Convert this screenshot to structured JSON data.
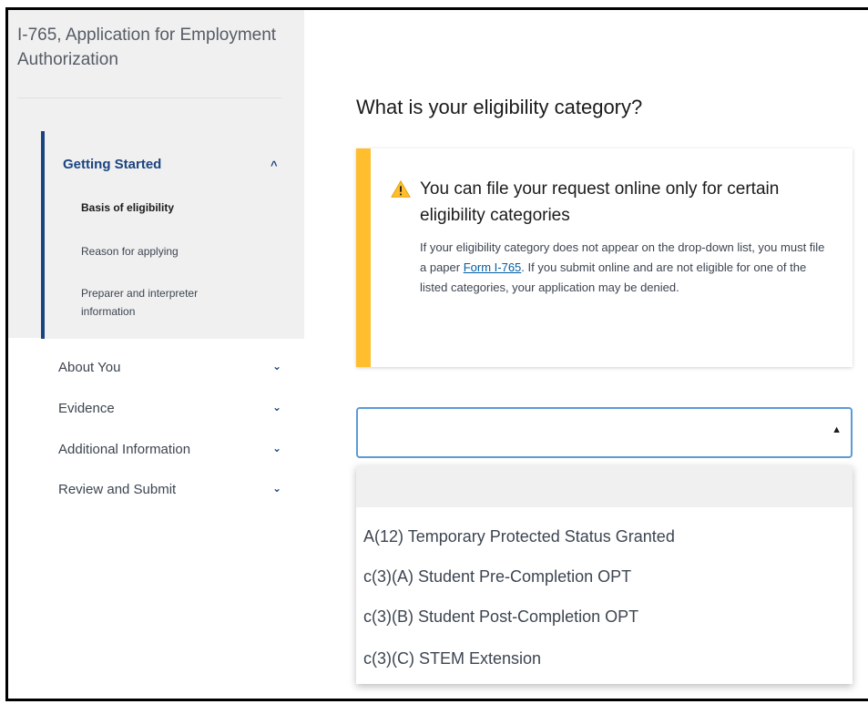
{
  "sidebar": {
    "form_title": "I-765, Application for Employment Authorization",
    "active_section": {
      "title": "Getting Started",
      "chevron": "^",
      "items": [
        {
          "label": "Basis of eligibility",
          "current": true
        },
        {
          "label": "Reason for applying",
          "current": false
        },
        {
          "label": "Preparer and interpreter information",
          "current": false
        }
      ]
    },
    "sections": [
      {
        "label": "About You",
        "chevron": "⌄"
      },
      {
        "label": "Evidence",
        "chevron": "⌄"
      },
      {
        "label": "Additional Information",
        "chevron": "⌄"
      },
      {
        "label": "Review and Submit",
        "chevron": "⌄"
      }
    ]
  },
  "main": {
    "question": "What is your eligibility category?",
    "alert": {
      "icon": "warning-icon",
      "heading": "You can file your request online only for certain eligibility categories",
      "body_before_link": "If your eligibility category does not appear on the drop-down list, you must file a paper ",
      "link_text": "Form I-765",
      "body_after_link": ". If you submit online and are not eligible for one of the listed categories, your application may be denied."
    },
    "select": {
      "value": "",
      "caret": "▲",
      "options": [
        "",
        "A(12) Temporary Protected Status Granted",
        "c(3)(A) Student Pre-Completion OPT",
        "c(3)(B) Student Post-Completion OPT",
        "c(3)(C) STEM Extension"
      ]
    }
  },
  "colors": {
    "accent": "#1a4480",
    "warning": "#ffbe2e",
    "focus": "#5b9bd5",
    "sidebar_bg": "#f0f0f0"
  }
}
